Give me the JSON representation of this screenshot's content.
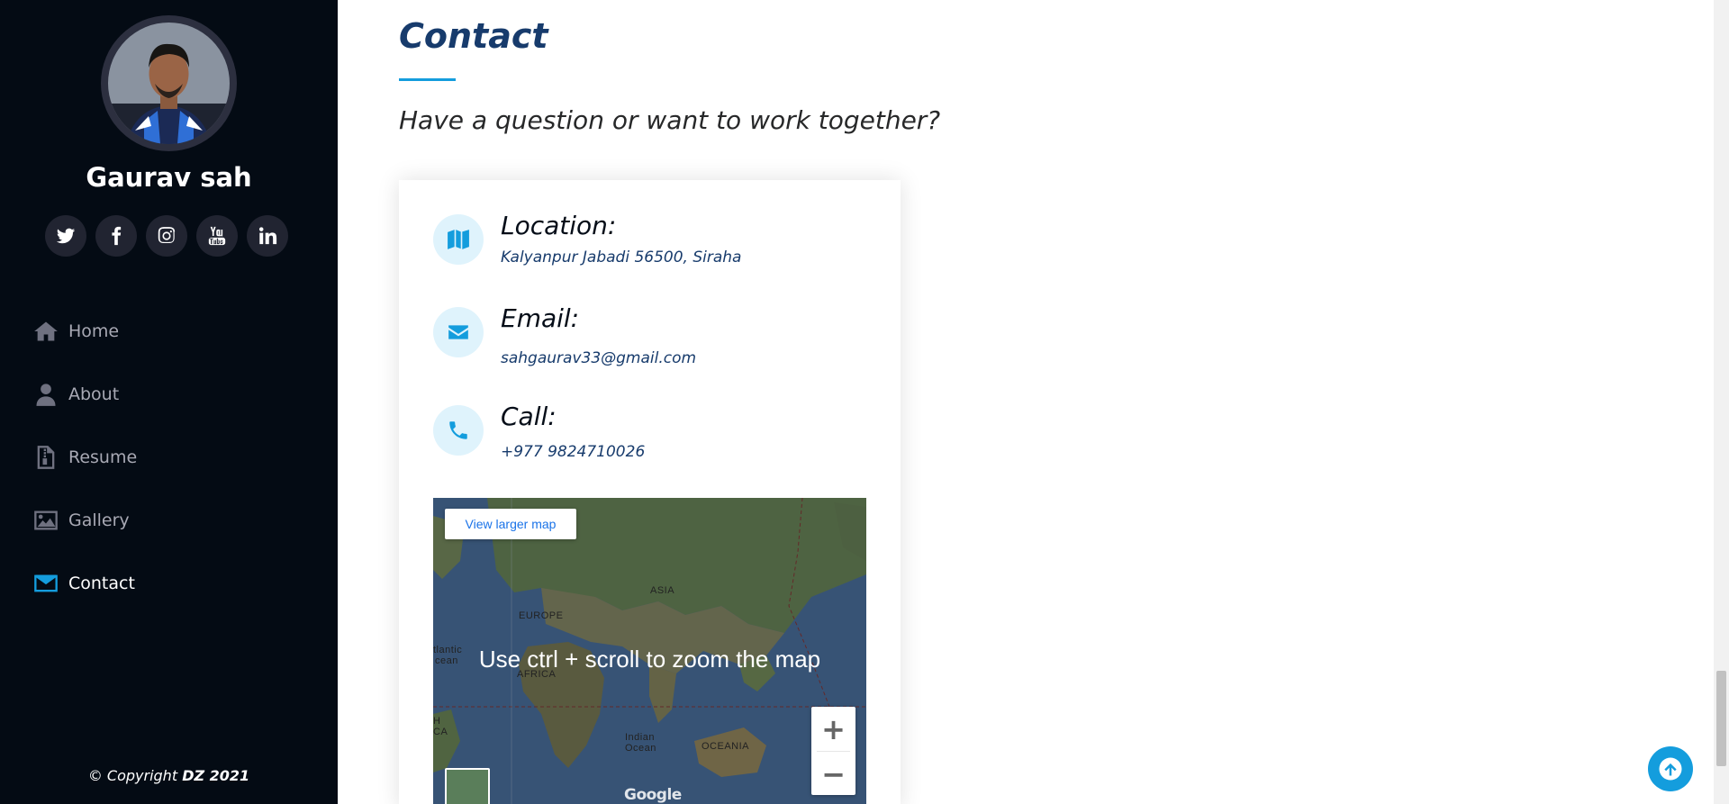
{
  "profile": {
    "name": "Gaurav sah"
  },
  "social": [
    {
      "icon": "twitter-icon"
    },
    {
      "icon": "facebook-icon"
    },
    {
      "icon": "instagram-icon"
    },
    {
      "icon": "youtube-icon"
    },
    {
      "icon": "linkedin-icon"
    }
  ],
  "nav": {
    "items": [
      {
        "label": "Home",
        "icon": "home-icon"
      },
      {
        "label": "About",
        "icon": "user-icon"
      },
      {
        "label": "Resume",
        "icon": "file-icon"
      },
      {
        "label": "Gallery",
        "icon": "image-icon"
      },
      {
        "label": "Contact",
        "icon": "envelope-icon",
        "active": true
      }
    ]
  },
  "footer": {
    "copyright_prefix": "© Copyright ",
    "copyright_brand": "DZ 2021"
  },
  "contact": {
    "title": "Contact",
    "subtitle": "Have a question or want to work together?",
    "location": {
      "heading": "Location:",
      "value": "Kalyanpur Jabadi 56500, Siraha"
    },
    "email": {
      "heading": "Email:",
      "value": "sahgaurav33@gmail.com"
    },
    "call": {
      "heading": "Call:",
      "value": "+977 9824710026"
    }
  },
  "map": {
    "view_larger_label": "View larger map",
    "hint": "Use ctrl + scroll to zoom the map",
    "labels": {
      "asia": "ASIA",
      "europe": "EUROPE",
      "africa": "AFRICA",
      "oceania": "OCEANIA",
      "indian_ocean_1": "Indian",
      "indian_ocean_2": "Ocean",
      "atlantic_1": "tlantic",
      "atlantic_2": "cean",
      "na_1": "H",
      "na_2": "CA"
    },
    "zoom_in": "+",
    "zoom_out": "−",
    "attribution": "Google"
  },
  "colors": {
    "accent": "#149ddd",
    "sidebar_bg": "#040b14",
    "title": "#173b6c"
  }
}
